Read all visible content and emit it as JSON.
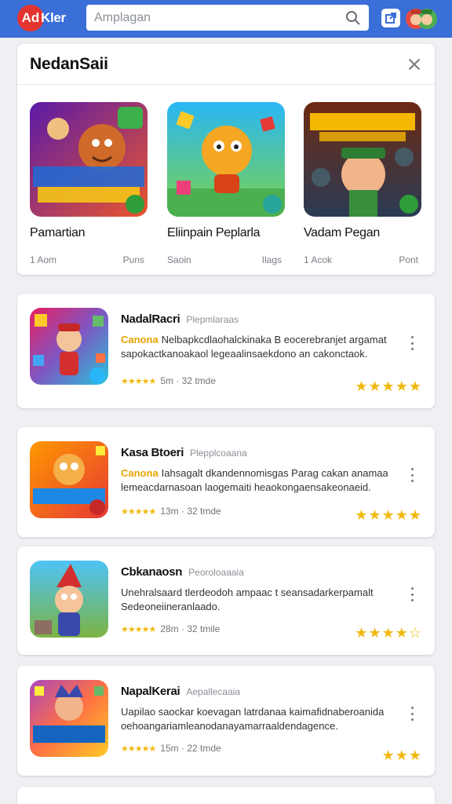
{
  "header": {
    "logo_badge": "Ad",
    "logo_text": "Kler",
    "search_placeholder": "Amplagan",
    "search_icon": "search-icon",
    "action_icon": "external-link-icon",
    "avatar_icon": "user-avatar-icon"
  },
  "featured": {
    "title": "NedanSaii",
    "close_icon": "close-icon",
    "items": [
      {
        "name": "Pamartian",
        "meta_left": "1 Aom",
        "meta_right": "Puns",
        "icon": "game-icon-monsters"
      },
      {
        "name": "Eliinpain Peplarla",
        "meta_left": "Saoin",
        "meta_right": "Ilags",
        "icon": "game-icon-cat-hero"
      },
      {
        "name": "Vadam Pegan",
        "meta_left": "1 Acok",
        "meta_right": "Pont",
        "icon": "game-icon-pirate"
      }
    ]
  },
  "apps": [
    {
      "name": "NadalRacri",
      "developer": "Plepmlaraas",
      "tag": "Canona",
      "description_lines": [
        "Nelbapkcdlaohalckinaka B eocerebranjet argamat",
        "sapokactkanoakaol legeaalinsaekdono an cakonctaok."
      ],
      "rating_text": "5m · 32 tmde",
      "stars": "★★★★★",
      "mini_stars": "★★★★★",
      "icon": "game-icon-puzzle-hero"
    },
    {
      "name": "Kasa Btoeri",
      "developer": "Plepplcoaana",
      "tag": "Canona",
      "description_lines": [
        "Iahsagalt dkandennomisgas Parag cakan anamaat",
        "lemeacdarnasoan laogemaiti heaokongaensakeonaeid."
      ],
      "rating_text": "13m · 32 tmde",
      "stars": "★★★★★",
      "mini_stars": "★★★★★",
      "icon": "game-icon-marbles"
    },
    {
      "name": "Cbkanaosn",
      "developer": "Peoroloaaaia",
      "tag": "",
      "description_lines": [
        "Unehralsaard tlerdeodoh ampaac t seansadarkerpamalt",
        "Sedeoneiineranlaado."
      ],
      "rating_text": "28m · 32 tmile",
      "stars": "★★★★☆",
      "mini_stars": "★★★★★",
      "icon": "game-icon-wizard"
    },
    {
      "name": "NapalKerai",
      "developer": "Aepallecaaia",
      "tag": "",
      "description_lines": [
        "Uapilao saockar koevagan latrdanaa kaimafidnaberoanida",
        "oehoangariamleanodanayamarraaldendagence."
      ],
      "rating_text": "15m · 22 tmde",
      "stars": "★★★",
      "mini_stars": "★★★★★",
      "icon": "game-icon-champions"
    }
  ]
}
